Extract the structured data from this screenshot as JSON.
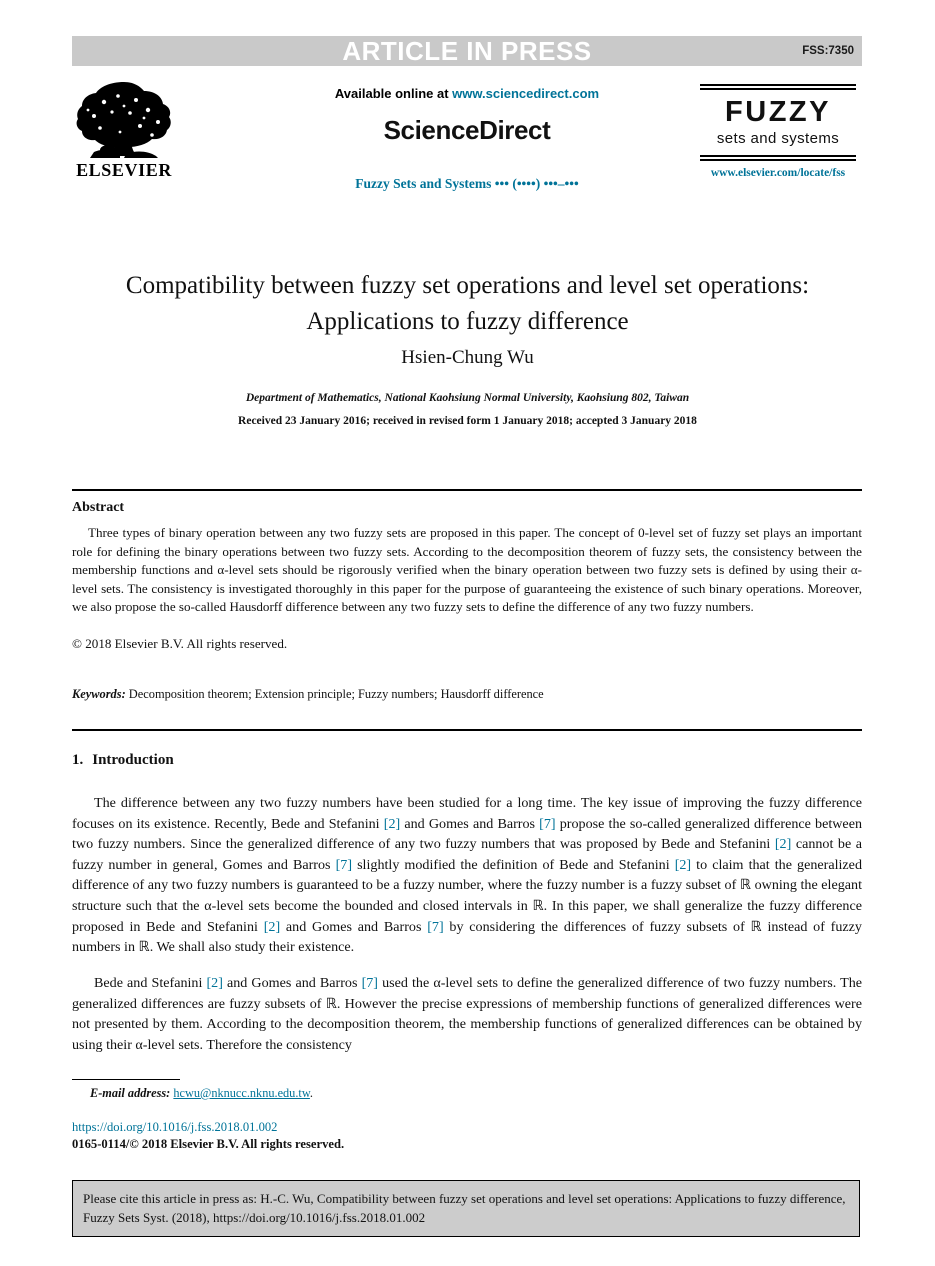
{
  "banner": {
    "label": "ARTICLE IN PRESS",
    "code": "FSS:7350",
    "bar_color": "#c9c9c9"
  },
  "masthead": {
    "publisher": "ELSEVIER",
    "available_prefix": "Available online at ",
    "available_url": "www.sciencedirect.com",
    "platform": "ScienceDirect",
    "journal_reference": "Fuzzy Sets and Systems ••• (••••) •••–•••",
    "logo": {
      "title": "FUZZY",
      "subtitle": "sets and systems"
    },
    "elsevier_url": "www.elsevier.com/locate/fss",
    "link_color": "#007398"
  },
  "article": {
    "title_line_1": "Compatibility between fuzzy set operations and level set operations:",
    "title_line_2": "Applications to fuzzy difference",
    "author": "Hsien-Chung Wu",
    "affiliation": "Department of Mathematics, National Kaohsiung Normal University, Kaohsiung 802, Taiwan",
    "history": "Received 23 January 2016; received in revised form 1 January 2018; accepted 3 January 2018"
  },
  "abstract": {
    "heading": "Abstract",
    "body": "Three types of binary operation between any two fuzzy sets are proposed in this paper. The concept of 0-level set of fuzzy set plays an important role for defining the binary operations between two fuzzy sets. According to the decomposition theorem of fuzzy sets, the consistency between the membership functions and α-level sets should be rigorously verified when the binary operation between two fuzzy sets is defined by using their α-level sets. The consistency is investigated thoroughly in this paper for the purpose of guaranteeing the existence of such binary operations. Moreover, we also propose the so-called Hausdorff difference between any two fuzzy sets to define the difference of any two fuzzy numbers.",
    "copyright": "© 2018 Elsevier B.V. All rights reserved."
  },
  "keywords": {
    "label": "Keywords:",
    "value": " Decomposition theorem; Extension principle; Fuzzy numbers; Hausdorff difference"
  },
  "section": {
    "number": "1.",
    "title": "Introduction",
    "paragraph_1_parts": [
      "The difference between any two fuzzy numbers have been studied for a long time. The key issue of improving the fuzzy difference focuses on its existence. Recently, Bede and Stefanini ",
      "[2]",
      " and Gomes and Barros ",
      "[7]",
      " propose the so-called generalized difference between two fuzzy numbers. Since the generalized difference of any two fuzzy numbers that was proposed by Bede and Stefanini ",
      "[2]",
      " cannot be a fuzzy number in general, Gomes and Barros ",
      "[7]",
      " slightly modified the definition of Bede and Stefanini ",
      "[2]",
      " to claim that the generalized difference of any two fuzzy numbers is guaranteed to be a fuzzy number, where the fuzzy number is a fuzzy subset of ℝ owning the elegant structure such that the α-level sets become the bounded and closed intervals in ℝ. In this paper, we shall generalize the fuzzy difference proposed in Bede and Stefanini ",
      "[2]",
      " and Gomes and Barros ",
      "[7]",
      " by considering the differences of fuzzy subsets of ℝ instead of fuzzy numbers in ℝ. We shall also study their existence."
    ],
    "paragraph_2_parts": [
      "Bede and Stefanini ",
      "[2]",
      " and Gomes and Barros ",
      "[7]",
      " used the α-level sets to define the generalized difference of two fuzzy numbers. The generalized differences are fuzzy subsets of ℝ. However the precise expressions of membership functions of generalized differences were not presented by them. According to the decomposition theorem, the membership functions of generalized differences can be obtained by using their α-level sets. Therefore the consistency"
    ],
    "reference_color": "#007398"
  },
  "footnote": {
    "email_label": "E-mail address:",
    "email_address": "hcwu@nknucc.nknu.edu.tw",
    "email_suffix": ".",
    "doi": "https://doi.org/10.1016/j.fss.2018.01.002",
    "issn": "0165-0114/© 2018 Elsevier B.V. All rights reserved."
  },
  "cite_box": {
    "text": "Please cite this article in press as: H.-C. Wu, Compatibility between fuzzy set operations and level set operations: Applications to fuzzy difference, Fuzzy Sets Syst. (2018), https://doi.org/10.1016/j.fss.2018.01.002",
    "background": "#cccccc"
  }
}
